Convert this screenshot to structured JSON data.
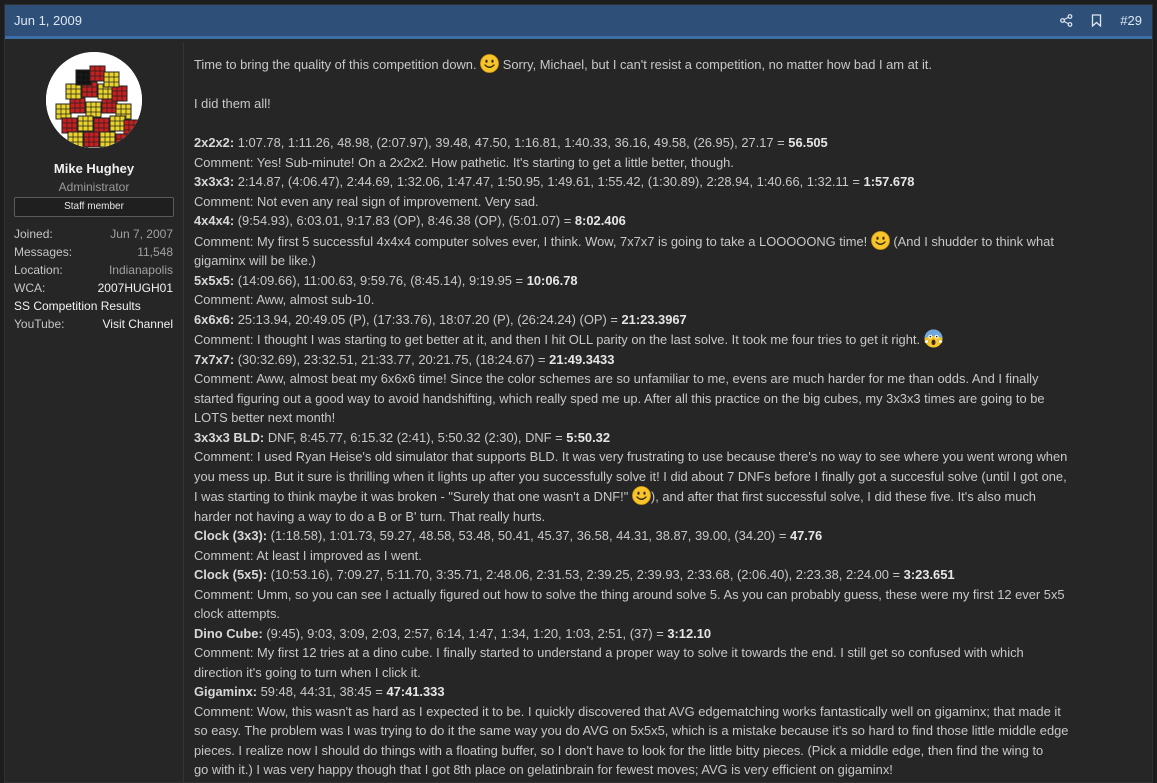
{
  "post": {
    "date": "Jun 1, 2009",
    "number": "#29",
    "header_icons": [
      "share-icon",
      "bookmark-icon"
    ],
    "accent_color": "#2d4f78"
  },
  "user": {
    "name": "Mike Hughey",
    "title": "Administrator",
    "badge": "Staff member",
    "joined_label": "Joined:",
    "joined": "Jun 7, 2007",
    "messages_label": "Messages:",
    "messages": "11,548",
    "location_label": "Location:",
    "location": "Indianapolis",
    "wca_label": "WCA:",
    "wca": "2007HUGH01",
    "results_link": "SS Competition Results",
    "youtube_label": "YouTube:",
    "youtube": "Visit Channel"
  },
  "body": {
    "intro_a": "Time to bring the quality of this competition down.",
    "intro_b": "Sorry, Michael, but I can't resist a competition, no matter how bad I am at it.",
    "did_all": "I did them all!",
    "events": [
      {
        "label": "2x2x2:",
        "times": "1:07.78, 1:11.26, 48.98, (2:07.97), 39.48, 47.50, 1:16.81, 1:40.33, 36.16, 49.58, (26.95), 27.17 =",
        "result": "56.505",
        "comment": "Comment: Yes! Sub-minute! On a 2x2x2. How pathetic. It's starting to get a little better, though."
      },
      {
        "label": "3x3x3:",
        "times": "2:14.87, (4:06.47), 2:44.69, 1:32.06, 1:47.47, 1:50.95, 1:49.61, 1:55.42, (1:30.89), 2:28.94, 1:40.66, 1:32.11 =",
        "result": "1:57.678",
        "comment": "Comment: Not even any real sign of improvement. Very sad."
      },
      {
        "label": "4x4x4:",
        "times": "(9:54.93), 6:03.01, 9:17.83 (OP), 8:46.38 (OP), (5:01.07) =",
        "result": "8:02.406",
        "comment_a": "Comment: My first 5 successful 4x4x4 computer solves ever, I think. Wow, 7x7x7 is going to take a LOOOOONG time!",
        "comment_b": "(And I shudder to think what",
        "comment_c": "gigaminx will be like.)"
      },
      {
        "label": "5x5x5:",
        "times": "(14:09.66), 11:00.63, 9:59.76, (8:45.14), 9:19.95 =",
        "result": "10:06.78",
        "comment": "Comment: Aww, almost sub-10."
      },
      {
        "label": "6x6x6:",
        "times": "25:13.94, 20:49.05 (P), (17:33.76), 18:07.20 (P), (26:24.24) (OP) =",
        "result": "21:23.3967",
        "comment": "Comment: I thought I was starting to get better at it, and then I hit OLL parity on the last solve. It took me four tries to get it right."
      },
      {
        "label": "7x7x7:",
        "times": "(30:32.69), 23:32.51, 21:33.77, 20:21.75, (18:24.67) =",
        "result": "21:49.3433",
        "comment_lines": [
          "Comment: Aww, almost beat my 6x6x6 time! Since the color schemes are so unfamiliar to me, evens are much harder for me than odds. And I finally",
          "started figuring out a good way to avoid handshifting, which really sped me up. After all this practice on the big cubes, my 3x3x3 times are going to be",
          "LOTS better next month!"
        ]
      },
      {
        "label": "3x3x3 BLD:",
        "times": "DNF, 8:45.77, 6:15.32 (2:41), 5:50.32 (2:30), DNF =",
        "result": "5:50.32",
        "comment_lines": [
          "Comment: I used Ryan Heise's old simulator that supports BLD. It was very frustrating to use because there's no way to see where you went wrong when",
          "you mess up. But it sure is thrilling when it lights up after you successfully solve it! I did about 7 DNFs before I finally got a succesful solve (until I got one,"
        ],
        "comment_d": "I was starting to think maybe it was broken - \"Surely that one wasn't a DNF!\"",
        "comment_e": "), and after that first successful solve, I did these five. It's also much",
        "comment_f": "harder not having a way to do a B or B' turn. That really hurts."
      },
      {
        "label": "Clock (3x3):",
        "times": "(1:18.58), 1:01.73, 59.27, 48.58, 53.48, 50.41, 45.37, 36.58, 44.31, 38.87, 39.00, (34.20) =",
        "result": "47.76",
        "comment": "Comment: At least I improved as I went."
      },
      {
        "label": "Clock (5x5):",
        "times": "(10:53.16), 7:09.27, 5:11.70, 3:35.71, 2:48.06, 2:31.53, 2:39.25, 2:39.93, 2:33.68, (2:06.40), 2:23.38, 2:24.00 =",
        "result": "3:23.651",
        "comment_lines": [
          "Comment: Umm, so you can see I actually figured out how to solve the thing around solve 5. As you can probably guess, these were my first 12 ever 5x5",
          "clock attempts."
        ]
      },
      {
        "label": "Dino Cube:",
        "times": "(9:45), 9:03, 3:09, 2:03, 2:57, 6:14, 1:47, 1:34, 1:20, 1:03, 2:51, (37) =",
        "result": "3:12.10",
        "comment_lines": [
          "Comment: My first 12 tries at a dino cube. I finally started to understand a proper way to solve it towards the end. I still get so confused with which",
          "direction it's going to turn when I click it."
        ]
      },
      {
        "label": "Gigaminx:",
        "times": "59:48, 44:31, 38:45 =",
        "result": "47:41.333",
        "comment_lines": [
          "Comment: Wow, this wasn't as hard as I expected it to be. I quickly discovered that AVG edgematching works fantastically well on gigaminx; that made it",
          "so easy. The problem was I was trying to do it the same way you do AVG on 5x5x5, which is a mistake because it's so hard to find those little middle edge",
          "pieces. I realize now I should do things with a floating buffer, so I don't have to look for the little bitty pieces. (Pick a middle edge, then find the wing to",
          "go with it.) I was very happy though that I got 8th place on gelatinbrain for fewest moves; AVG is very efficient on gigaminx!"
        ]
      }
    ]
  }
}
